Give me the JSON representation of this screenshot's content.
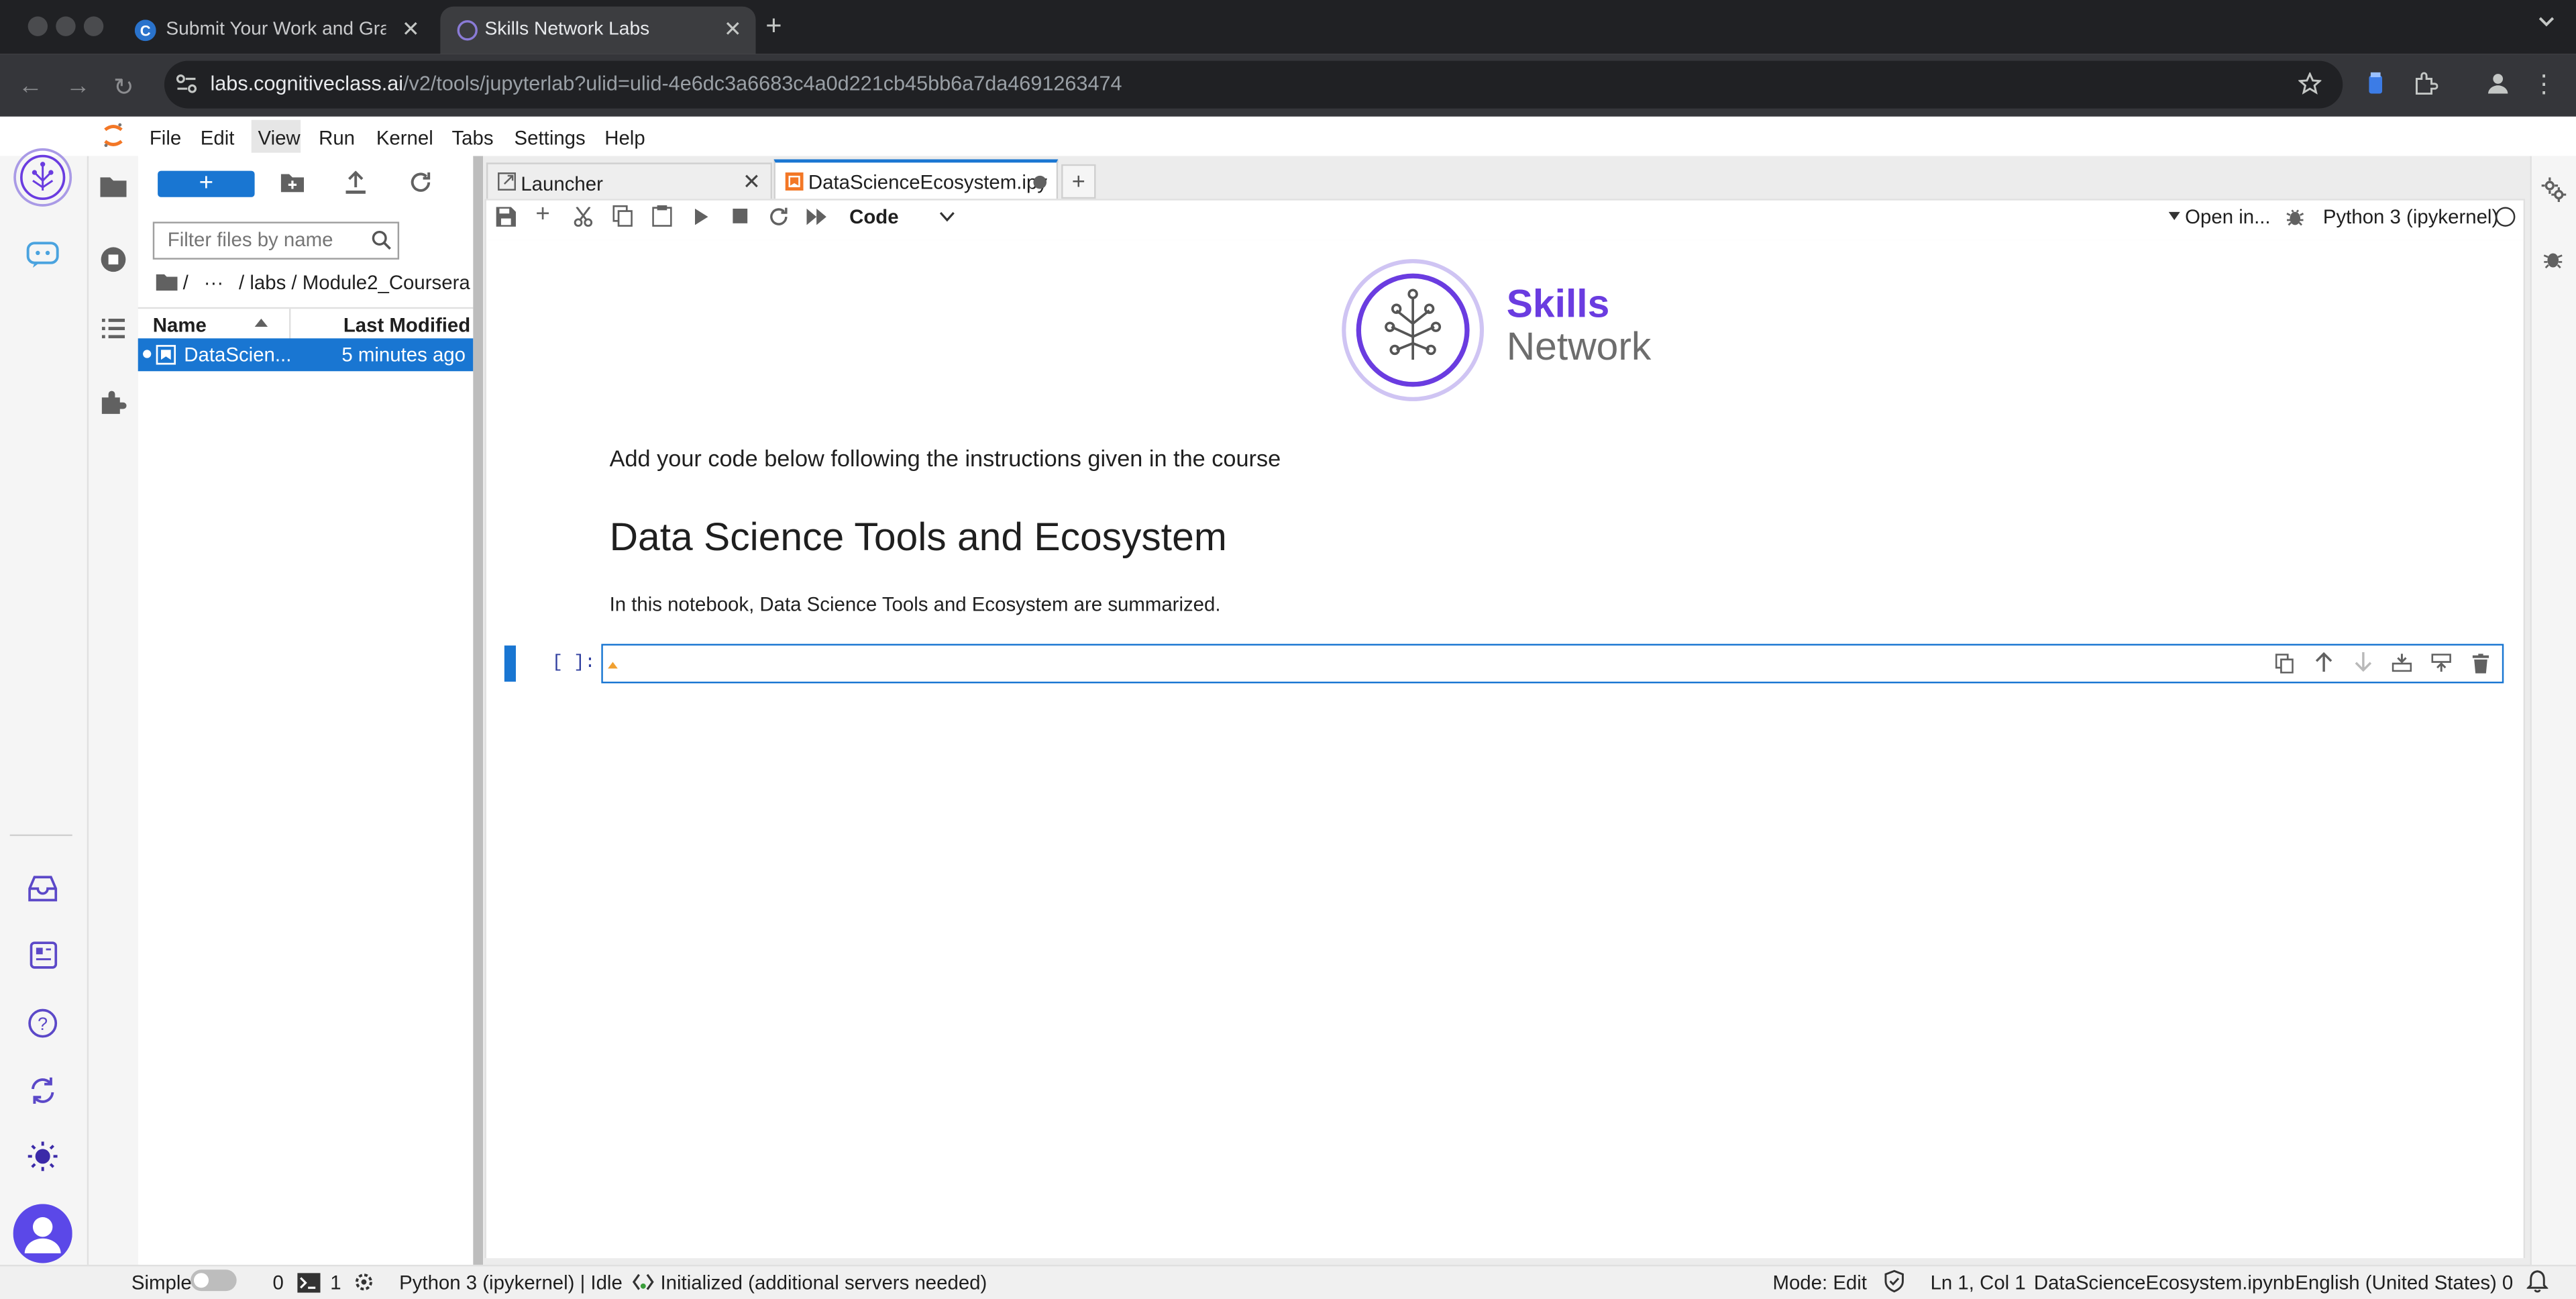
{
  "browser": {
    "tabs": [
      {
        "label": "Submit Your Work and Grade"
      },
      {
        "label": "Skills Network Labs"
      }
    ],
    "url": {
      "host": "labs.cognitiveclass.ai",
      "path": "/v2/tools/jupyterlab?ulid=ulid-4e6dc3a6683c4a0d221cb45bb6a7da4691263474"
    }
  },
  "menubar": {
    "items": [
      "File",
      "Edit",
      "View",
      "Run",
      "Kernel",
      "Tabs",
      "Settings",
      "Help"
    ]
  },
  "filebrowser": {
    "new_label": "+",
    "filter_placeholder": "Filter files by name",
    "breadcrumb": {
      "root": "/",
      "ellipsis": "···",
      "path": "/ labs / Module2_Coursera /"
    },
    "columns": {
      "name": "Name",
      "modified": "Last Modified"
    },
    "rows": [
      {
        "name": "DataScien...",
        "modified": "5 minutes ago"
      }
    ]
  },
  "doc_tabs": [
    {
      "label": "Launcher"
    },
    {
      "label": "DataScienceEcosystem.ipy"
    }
  ],
  "notebook_toolbar": {
    "cell_type": "Code",
    "open_in": "Open in...",
    "kernel": "Python 3 (ipykernel)"
  },
  "notebook": {
    "logo": {
      "line1": "Skills",
      "line2": "Network"
    },
    "intro": "Add your code below following the instructions given in the course",
    "heading": "Data Science Tools and Ecosystem",
    "summary": "In this notebook, Data Science Tools and Ecosystem are summarized.",
    "cell_prompt": "[ ]:"
  },
  "statusbar": {
    "mode_simple": "Simple",
    "terminals": "0",
    "kernels": "1",
    "kernel_status": "Python 3 (ipykernel) | Idle",
    "lsp_status": "Initialized (additional servers needed)",
    "mode": "Mode: Edit",
    "cursor": "Ln 1, Col 1",
    "filename": "DataScienceEcosystem.ipynb",
    "language": "English (United States)",
    "notifications": "0"
  },
  "colors": {
    "accent": "#1976d2",
    "brand_purple": "#6a3ce0",
    "chrome_dark": "#202124"
  }
}
